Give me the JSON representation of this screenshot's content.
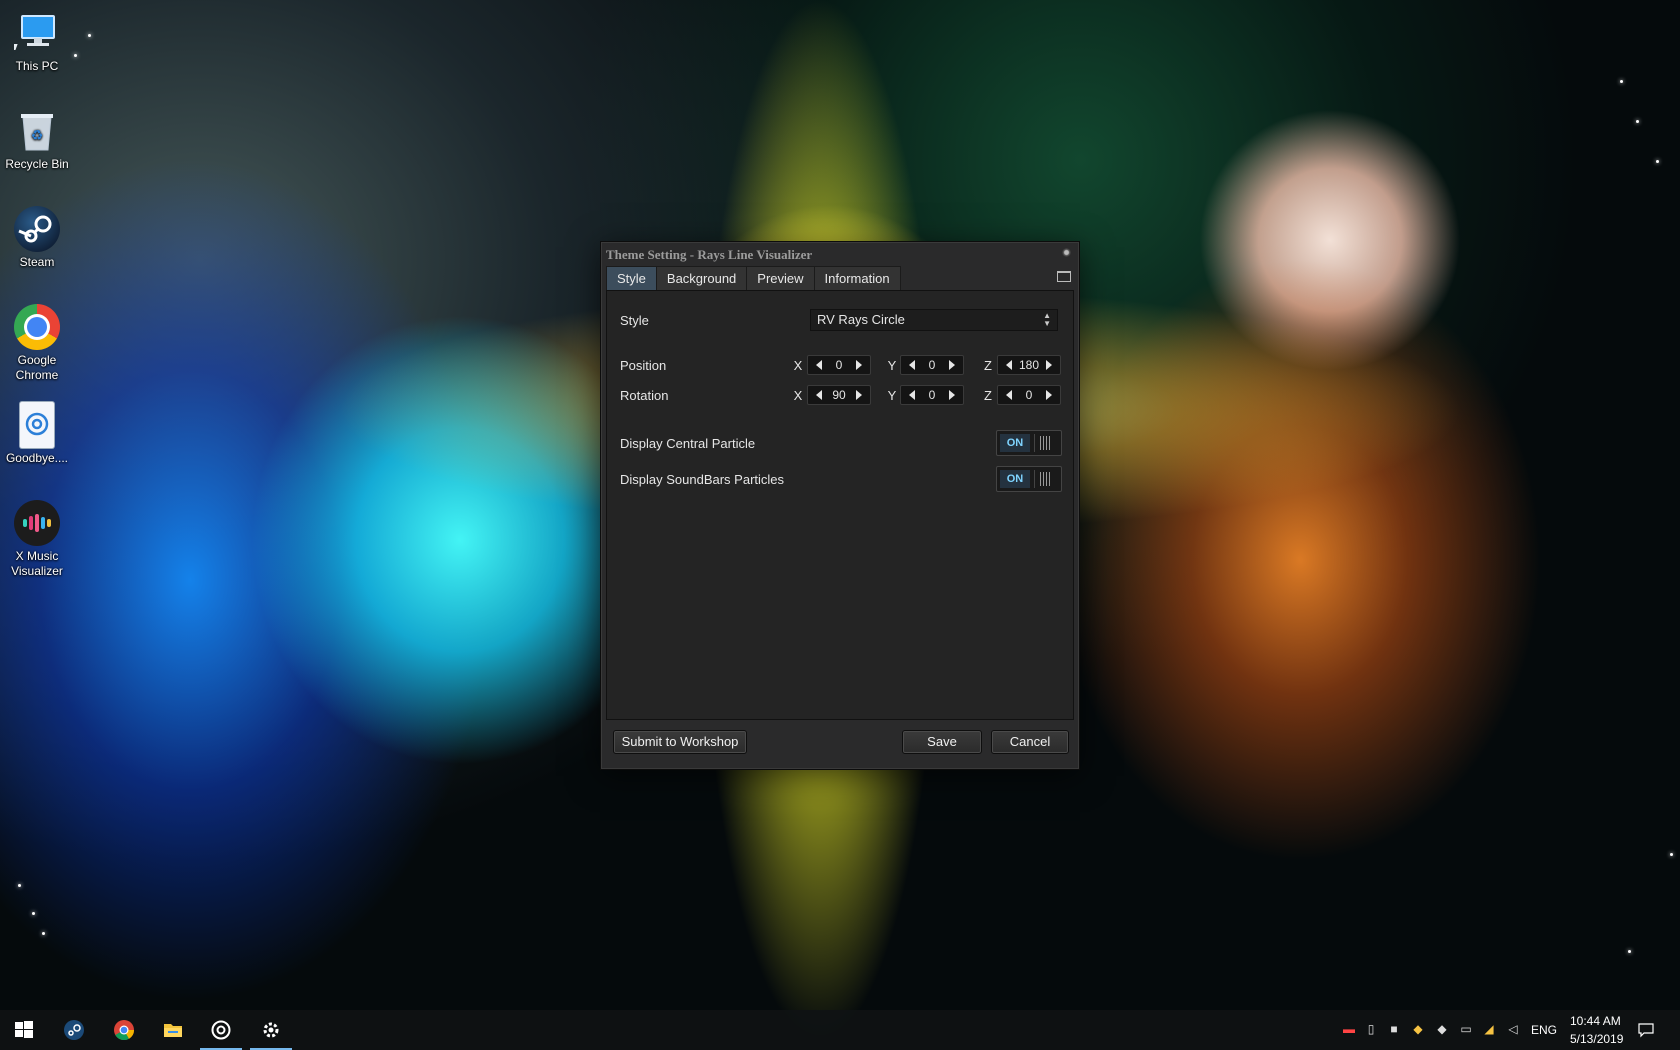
{
  "desktop": {
    "icons": [
      {
        "label": "This PC",
        "icon": "computer-icon"
      },
      {
        "label": "Recycle Bin",
        "icon": "recycle-bin-icon"
      },
      {
        "label": "Steam",
        "icon": "steam-icon"
      },
      {
        "label": "Google Chrome",
        "icon": "chrome-icon"
      },
      {
        "label": "Goodbye....",
        "icon": "document-icon"
      },
      {
        "label": "X Music Visualizer",
        "icon": "x-music-visualizer-icon"
      }
    ]
  },
  "dialog": {
    "title": "Theme Setting - Rays Line Visualizer",
    "tabs": [
      "Style",
      "Background",
      "Preview",
      "Information"
    ],
    "active_tab": "Style",
    "style_label": "Style",
    "style_value": "RV Rays Circle",
    "position": {
      "label": "Position",
      "x_label": "X",
      "x": "0",
      "y_label": "Y",
      "y": "0",
      "z_label": "Z",
      "z": "180"
    },
    "rotation": {
      "label": "Rotation",
      "x_label": "X",
      "x": "90",
      "y_label": "Y",
      "y": "0",
      "z_label": "Z",
      "z": "0"
    },
    "central_particle": {
      "label": "Display Central Particle",
      "toggle": "ON"
    },
    "soundbars_particles": {
      "label": "Display SoundBars Particles",
      "toggle": "ON"
    },
    "submit_label": "Submit to Workshop",
    "save_label": "Save",
    "cancel_label": "Cancel",
    "accent_color": "#7fd4ff"
  },
  "taskbar": {
    "pinned": [
      "start-icon",
      "steam-icon",
      "chrome-icon",
      "file-explorer-icon",
      "visualizer-icon",
      "settings-icon"
    ],
    "language": "ENG",
    "time": "10:44 AM",
    "date": "5/13/2019"
  }
}
